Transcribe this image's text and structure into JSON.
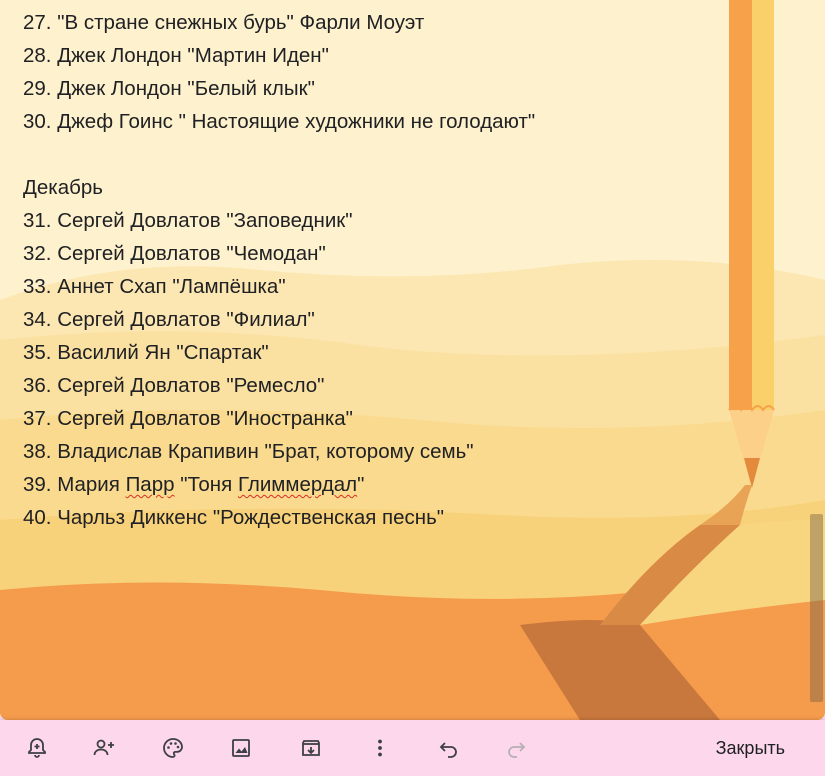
{
  "note": {
    "lines": [
      {
        "parts": [
          {
            "t": "27. \"В стране снежных бурь\" Фарли Моуэт"
          }
        ]
      },
      {
        "parts": [
          {
            "t": "28. Джек Лондон \"Мартин Иден\""
          }
        ]
      },
      {
        "parts": [
          {
            "t": "29. Джек Лондон \"Белый клык\""
          }
        ]
      },
      {
        "parts": [
          {
            "t": "30. Джеф Гоинс \" Настоящие художники не голодают\""
          }
        ]
      },
      {
        "parts": [
          {
            "t": ""
          }
        ]
      },
      {
        "parts": [
          {
            "t": "Декабрь"
          }
        ]
      },
      {
        "parts": [
          {
            "t": "31. Сергей Довлатов \"Заповедник\""
          }
        ]
      },
      {
        "parts": [
          {
            "t": "32. Сергей Довлатов \"Чемодан\""
          }
        ]
      },
      {
        "parts": [
          {
            "t": "33. Аннет Схап \"Лампёшка\""
          }
        ]
      },
      {
        "parts": [
          {
            "t": "34. Сергей Довлатов \"Филиал\""
          }
        ]
      },
      {
        "parts": [
          {
            "t": "35. Василий Ян \"Спартак\""
          }
        ]
      },
      {
        "parts": [
          {
            "t": "36. Сергей Довлатов \"Ремесло\""
          }
        ]
      },
      {
        "parts": [
          {
            "t": "37. Сергей Довлатов \"Иностранка\""
          }
        ]
      },
      {
        "parts": [
          {
            "t": "38. Владислав Крапивин \"Брат, которому семь\""
          }
        ]
      },
      {
        "parts": [
          {
            "t": "39. Мария "
          },
          {
            "t": "Парр",
            "spell": true
          },
          {
            "t": " \"Тоня "
          },
          {
            "t": "Глиммердал",
            "spell": true
          },
          {
            "t": "\""
          }
        ]
      },
      {
        "parts": [
          {
            "t": "40. Чарльз Диккенс \"Рождественская песнь\""
          }
        ]
      }
    ]
  },
  "toolbar": {
    "buttons": [
      {
        "name": "remind-me-icon"
      },
      {
        "name": "collaborator-icon"
      },
      {
        "name": "palette-icon"
      },
      {
        "name": "image-icon"
      },
      {
        "name": "archive-icon"
      },
      {
        "name": "more-vert-icon"
      },
      {
        "name": "undo-icon"
      },
      {
        "name": "redo-icon"
      }
    ],
    "close_label": "Закрыть"
  },
  "colors": {
    "toolbar_bg": "#fdd7ec",
    "text": "#202124",
    "sand_light": "#fdedc2",
    "sand_mid": "#f8d77f",
    "sand_orange": "#f4994a",
    "road_brown": "#c8773d"
  }
}
